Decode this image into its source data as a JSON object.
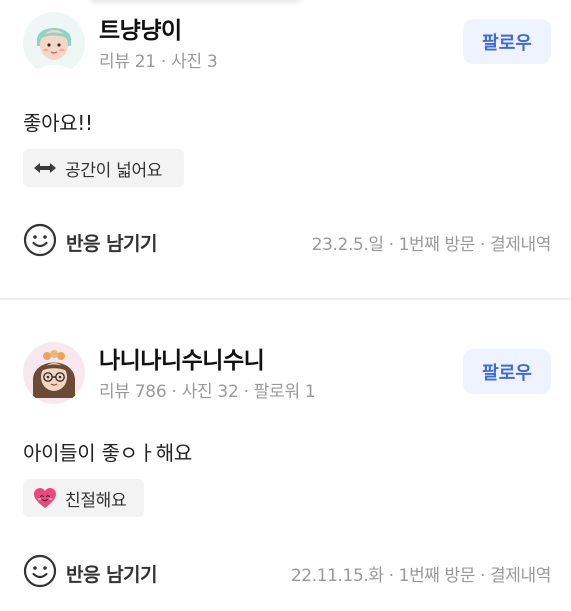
{
  "reviews": [
    {
      "nickname": "트냥냥이",
      "stats": "리뷰 21 · 사진 3",
      "follow_label": "팔로우",
      "text": "좋아요!!",
      "tag": {
        "icon": "left-right-arrow-icon",
        "label": "공간이 넓어요"
      },
      "reaction_label": "반응 남기기",
      "meta": "23.2.5.일 · 1번째 방문 · 결제내역"
    },
    {
      "nickname": "나니나니수니수니",
      "stats": "리뷰 786 · 사진 32 · 팔로워 1",
      "follow_label": "팔로우",
      "text": "아이들이 좋ㅇㅏ해요",
      "tag": {
        "icon": "heart-icon",
        "label": "친절해요"
      },
      "reaction_label": "반응 남기기",
      "meta": "22.11.15.화 · 1번째 방문 · 결제내역"
    }
  ],
  "colors": {
    "accent": "#3f6bd6",
    "follow_bg": "#eef3ff",
    "tag_bg": "#f3f3f3",
    "muted_text": "#9a9a9a",
    "heart": "#e84a7f"
  }
}
